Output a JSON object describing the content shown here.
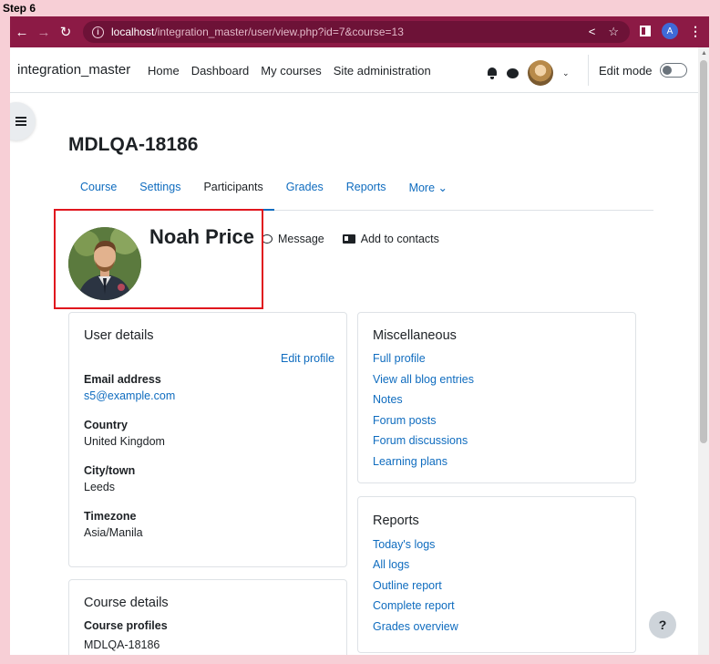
{
  "step_label": "Step 6",
  "browser": {
    "url_host": "localhost",
    "url_rest": "/integration_master/user/view.php?id=7&course=13",
    "profile_initial": "A"
  },
  "navbar": {
    "site_name": "integration_master",
    "links": [
      "Home",
      "Dashboard",
      "My courses",
      "Site administration"
    ],
    "edit_mode_label": "Edit mode"
  },
  "course": {
    "title": "MDLQA-18186",
    "tabs": [
      "Course",
      "Settings",
      "Participants",
      "Grades",
      "Reports",
      "More ⌄"
    ],
    "active_tab": "Participants"
  },
  "user": {
    "name": "Noah Price",
    "message_label": "Message",
    "add_contact_label": "Add to contacts"
  },
  "user_details": {
    "title": "User details",
    "edit_profile": "Edit profile",
    "fields": [
      {
        "label": "Email address",
        "value": "s5@example.com",
        "is_link": true
      },
      {
        "label": "Country",
        "value": "United Kingdom"
      },
      {
        "label": "City/town",
        "value": "Leeds"
      },
      {
        "label": "Timezone",
        "value": "Asia/Manila"
      }
    ]
  },
  "course_details": {
    "title": "Course details",
    "label": "Course profiles",
    "value": "MDLQA-18186"
  },
  "miscellaneous": {
    "title": "Miscellaneous",
    "links": [
      "Full profile",
      "View all blog entries",
      "Notes",
      "Forum posts",
      "Forum discussions",
      "Learning plans"
    ]
  },
  "reports": {
    "title": "Reports",
    "links": [
      "Today's logs",
      "All logs",
      "Outline report",
      "Complete report",
      "Grades overview"
    ]
  },
  "help_label": "?"
}
